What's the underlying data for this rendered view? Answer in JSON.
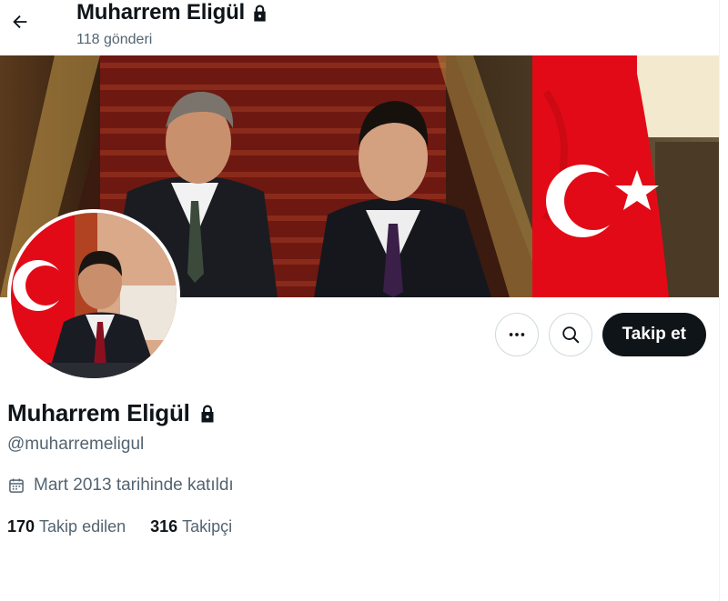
{
  "header": {
    "back_icon": "arrow-left-icon",
    "title": "Muharrem Eligül",
    "lock_icon": "lock-icon",
    "posts_count": "118 gönderi"
  },
  "banner": {
    "description_icon": "banner-photo"
  },
  "profile": {
    "display_name": "Muharrem Eligül",
    "handle": "@muharremeligul",
    "joined_icon": "calendar-icon",
    "joined": "Mart 2013 tarihinde katıldı",
    "following_count": "170",
    "following_label": "Takip edilen",
    "followers_count": "316",
    "followers_label": "Takipçi"
  },
  "actions": {
    "more_icon": "more-horizontal-icon",
    "search_icon": "search-icon",
    "follow_label": "Takip et"
  },
  "colors": {
    "text_primary": "#0f1419",
    "text_secondary": "#536471",
    "border": "#cfd9de",
    "flag_red": "#e30a17"
  }
}
